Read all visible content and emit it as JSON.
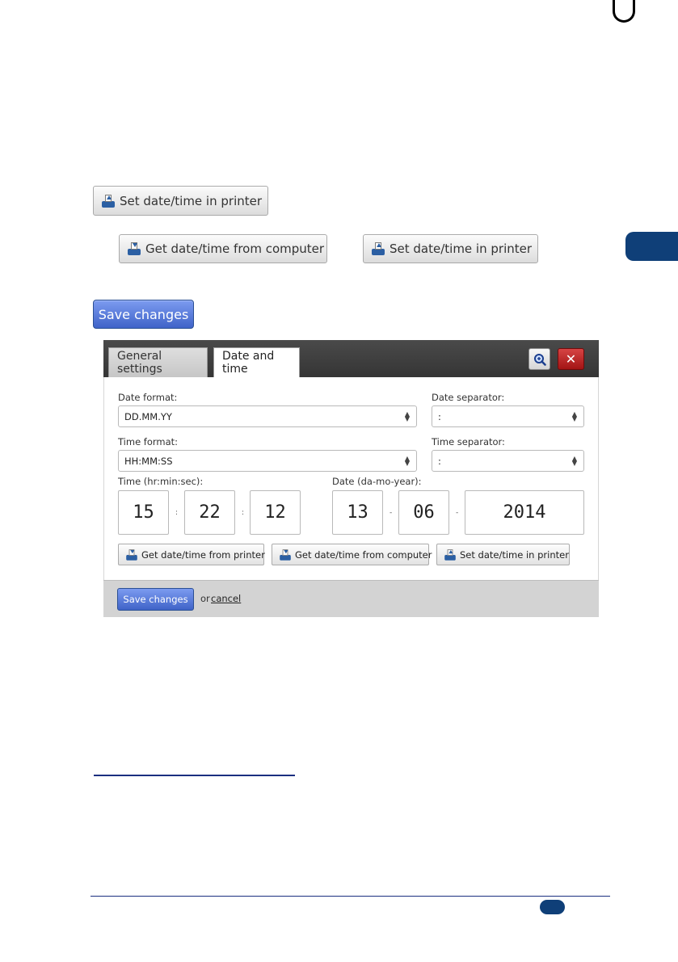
{
  "standalone_buttons": {
    "set_printer_top": "Set date/time in printer",
    "get_from_computer": "Get date/time from computer",
    "set_printer_mid": "Set date/time in printer",
    "save_changes": "Save changes"
  },
  "dialog": {
    "tabs": [
      {
        "label": "General settings",
        "active": false
      },
      {
        "label": "Date and time",
        "active": true
      }
    ],
    "zoom_icon": "zoom-icon",
    "close_icon": "close-icon",
    "date_format": {
      "label": "Date format:",
      "value": "DD.MM.YY"
    },
    "date_separator": {
      "label": "Date separator:",
      "value": ":"
    },
    "time_format": {
      "label": "Time format:",
      "value": "HH:MM:SS"
    },
    "time_separator": {
      "label": "Time separator:",
      "value": ":"
    },
    "time": {
      "label": "Time (hr:min:sec):",
      "hours": "15",
      "minutes": "22",
      "seconds": "12",
      "sep": ":"
    },
    "date": {
      "label": "Date (da-mo-year):",
      "day": "13",
      "month": "06",
      "year": "2014",
      "sep": "-"
    },
    "buttons": {
      "get_from_printer": "Get date/time from printer",
      "get_from_computer": "Get date/time from computer",
      "set_in_printer": "Set date/time in printer"
    },
    "footer": {
      "save_label": "Save changes",
      "or": "or",
      "cancel": "cancel"
    }
  },
  "colors": {
    "accent_blue": "#3f63c8",
    "navy": "#0f3f78",
    "close_red": "#a31414"
  }
}
